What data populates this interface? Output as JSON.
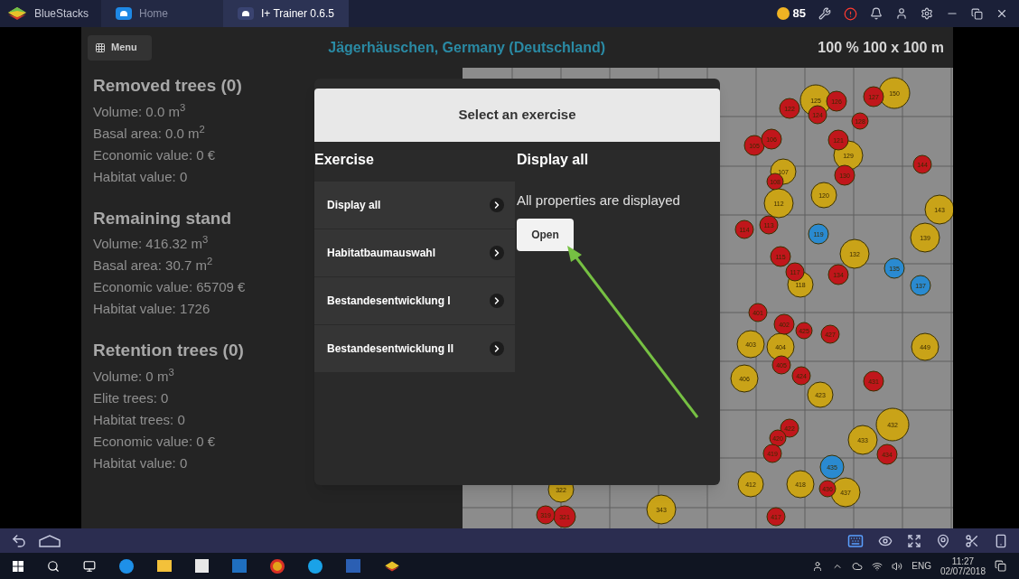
{
  "title_bar": {
    "app_name": "BlueStacks",
    "tabs": [
      {
        "label": "Home",
        "selected": false
      },
      {
        "label": "I+ Trainer 0.6.5",
        "selected": true
      }
    ],
    "coins": "85"
  },
  "app_bar": {
    "menu": "Menu",
    "location": "Jägerhäuschen, Germany (Deutschland)",
    "scale": "100 % 100 x 100 m"
  },
  "stats": [
    {
      "heading": "Removed trees (0)",
      "lines": [
        "Volume: 0.0 m$^{3}$",
        "Basal area: 0.0 m$^{2}$",
        "Economic value: 0 €",
        "Habitat value: 0"
      ]
    },
    {
      "heading": "Remaining stand",
      "lines": [
        "Volume: 416.32 m$^{3}$",
        "Basal area: 30.7 m$^{2}$",
        "Economic value: 65709 €",
        "Habitat value: 1726"
      ]
    },
    {
      "heading": "Retention trees (0)",
      "lines": [
        "Volume: 0 m$^{3}$",
        "Elite trees: 0",
        "Habitat trees: 0",
        "Economic value: 0 €",
        "Habitat value: 0"
      ]
    }
  ],
  "map": {
    "trees": [
      {
        "label": "125",
        "color": "#c9a318"
      },
      {
        "label": "150",
        "color": "#c9a318"
      },
      {
        "label": "127",
        "color": "#c0161b"
      },
      {
        "label": "126",
        "color": "#c0161b"
      },
      {
        "label": "124",
        "color": "#c0161b"
      },
      {
        "label": "122",
        "color": "#c0161b"
      },
      {
        "label": "129",
        "color": "#c9a318"
      },
      {
        "label": "121",
        "color": "#c0161b"
      },
      {
        "label": "130",
        "color": "#c0161b"
      },
      {
        "label": "107",
        "color": "#c9a318"
      },
      {
        "label": "108",
        "color": "#c0161b"
      },
      {
        "label": "112",
        "color": "#c9a318"
      },
      {
        "label": "120",
        "color": "#c9a318"
      },
      {
        "label": "119",
        "color": "#2a8ad0"
      },
      {
        "label": "132",
        "color": "#c9a318"
      },
      {
        "label": "139",
        "color": "#c9a318"
      },
      {
        "label": "143",
        "color": "#c9a318"
      },
      {
        "label": "144",
        "color": "#c0161b"
      },
      {
        "label": "113",
        "color": "#c0161b"
      },
      {
        "label": "114",
        "color": "#c0161b"
      },
      {
        "label": "115",
        "color": "#c0161b"
      },
      {
        "label": "118",
        "color": "#c9a318"
      },
      {
        "label": "117",
        "color": "#c0161b"
      },
      {
        "label": "134",
        "color": "#c0161b"
      },
      {
        "label": "135",
        "color": "#2a8ad0"
      },
      {
        "label": "137",
        "color": "#2a8ad0"
      },
      {
        "label": "105",
        "color": "#c0161b"
      },
      {
        "label": "106",
        "color": "#c0161b"
      },
      {
        "label": "128",
        "color": "#c0161b"
      },
      {
        "label": "403",
        "color": "#c9a318"
      },
      {
        "label": "404",
        "color": "#c9a318"
      },
      {
        "label": "401",
        "color": "#c0161b"
      },
      {
        "label": "402",
        "color": "#c0161b"
      },
      {
        "label": "405",
        "color": "#c0161b"
      },
      {
        "label": "406",
        "color": "#c9a318"
      },
      {
        "label": "423",
        "color": "#c9a318"
      },
      {
        "label": "425",
        "color": "#c0161b"
      },
      {
        "label": "424",
        "color": "#c0161b"
      },
      {
        "label": "427",
        "color": "#c0161b"
      },
      {
        "label": "431",
        "color": "#c0161b"
      },
      {
        "label": "432",
        "color": "#c9a318"
      },
      {
        "label": "433",
        "color": "#c9a318"
      },
      {
        "label": "434",
        "color": "#c0161b"
      },
      {
        "label": "435",
        "color": "#2a8ad0"
      },
      {
        "label": "437",
        "color": "#c9a318"
      },
      {
        "label": "436",
        "color": "#c0161b"
      },
      {
        "label": "418",
        "color": "#c9a318"
      },
      {
        "label": "412",
        "color": "#c9a318"
      },
      {
        "label": "449",
        "color": "#c9a318"
      },
      {
        "label": "422",
        "color": "#c0161b"
      },
      {
        "label": "420",
        "color": "#c0161b"
      },
      {
        "label": "419",
        "color": "#c0161b"
      },
      {
        "label": "343",
        "color": "#c9a318"
      },
      {
        "label": "322",
        "color": "#c9a318"
      },
      {
        "label": "321",
        "color": "#c0161b"
      },
      {
        "label": "319",
        "color": "#c0161b"
      },
      {
        "label": "417",
        "color": "#c0161b"
      }
    ]
  },
  "dialog": {
    "title": "Select an exercise",
    "list_heading": "Exercise",
    "exercises": [
      "Display all",
      "Habitatbaumauswahl",
      "Bestandesentwicklung I",
      "Bestandesentwicklung II"
    ],
    "detail_heading": "Display all",
    "description": "All properties are displayed",
    "open_button": "Open"
  },
  "taskbar": {
    "language": "ENG",
    "time": "11:27",
    "date": "02/07/2018"
  }
}
